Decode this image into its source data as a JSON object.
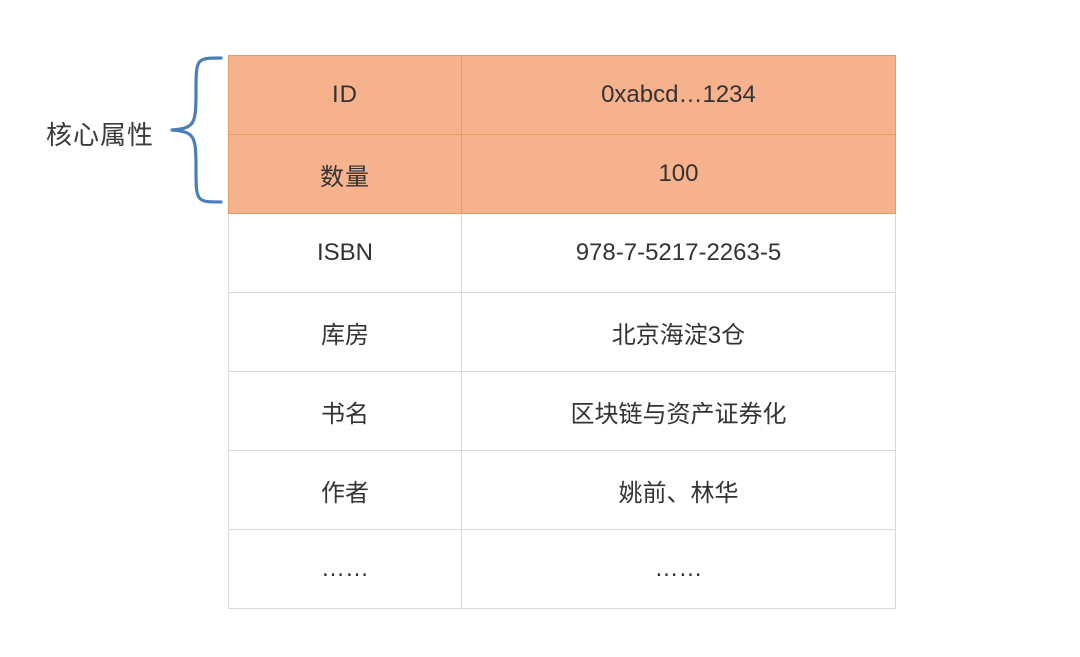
{
  "label": "核心属性",
  "rows": [
    {
      "key": "ID",
      "value": "0xabcd…1234",
      "core": true
    },
    {
      "key": "数量",
      "value": "100",
      "core": true
    },
    {
      "key": "ISBN",
      "value": "978-7-5217-2263-5",
      "core": false
    },
    {
      "key": "库房",
      "value": "北京海淀3仓",
      "core": false
    },
    {
      "key": "书名",
      "value": "区块链与资产证券化",
      "core": false
    },
    {
      "key": "作者",
      "value": "姚前、林华",
      "core": false
    },
    {
      "key": "……",
      "value": "……",
      "core": false
    }
  ],
  "colors": {
    "core_bg": "#f6b28c",
    "core_border": "#e89b67",
    "border": "#d9d9d9",
    "brace": "#4a7ebb"
  }
}
